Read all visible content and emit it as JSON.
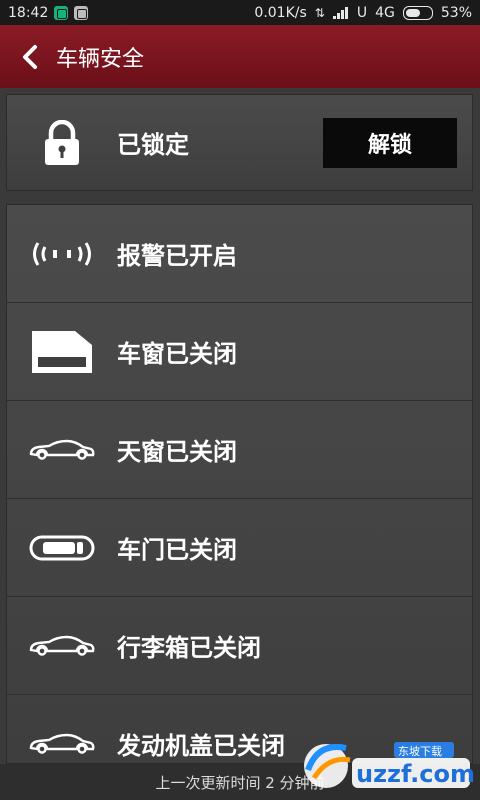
{
  "status_bar": {
    "time": "18:42",
    "speed": "0.01K/s",
    "carrier": "U",
    "network": "4G",
    "battery": "53%"
  },
  "header": {
    "title": "车辆安全",
    "back_icon": "chevron-left-icon"
  },
  "lock": {
    "icon": "lock-icon",
    "status": "已锁定",
    "button_label": "解锁"
  },
  "items": [
    {
      "icon": "alarm-icon",
      "label": "报警已开启"
    },
    {
      "icon": "car-window-icon",
      "label": "车窗已关闭"
    },
    {
      "icon": "car-icon",
      "label": "天窗已关闭"
    },
    {
      "icon": "car-door-icon",
      "label": "车门已关闭"
    },
    {
      "icon": "car-icon",
      "label": "行李箱已关闭"
    },
    {
      "icon": "car-icon",
      "label": "发动机盖已关闭"
    }
  ],
  "footer": {
    "text": "上一次更新时间 2 分钟前"
  },
  "watermark": {
    "text": "uzzf.com",
    "subtext": "东坡下载"
  },
  "colors": {
    "header": "#7a1520",
    "background": "#3a3a3a",
    "button": "#0a0a0a"
  }
}
